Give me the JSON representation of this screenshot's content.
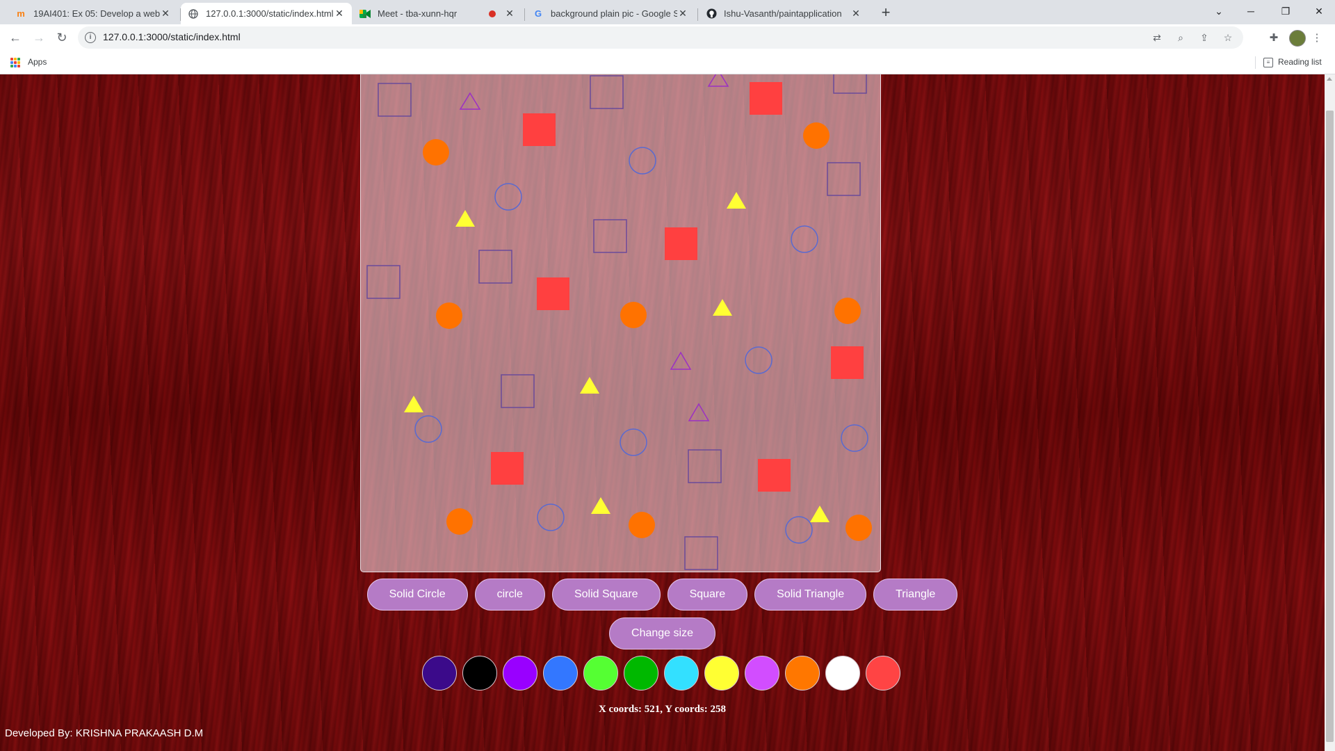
{
  "browser": {
    "tabs": [
      {
        "title": "19AI401: Ex 05: Develop a webpa",
        "icon": "moodle-icon",
        "active": false
      },
      {
        "title": "127.0.0.1:3000/static/index.html",
        "icon": "globe-icon",
        "active": true
      },
      {
        "title": "Meet - tba-xunn-hqr",
        "icon": "meet-icon",
        "active": false,
        "recording": true
      },
      {
        "title": "background plain pic - Google Se",
        "icon": "google-icon",
        "active": false
      },
      {
        "title": "Ishu-Vasanth/paintapplication",
        "icon": "github-icon",
        "active": false
      }
    ],
    "new_tab": "+",
    "url": "127.0.0.1:3000/static/index.html",
    "bookmarks": {
      "apps_label": "Apps",
      "reading_list_label": "Reading list"
    }
  },
  "page": {
    "buttons": {
      "solid_circle": "Solid Circle",
      "circle": "circle",
      "solid_square": "Solid Square",
      "square": "Square",
      "solid_triangle": "Solid Triangle",
      "triangle": "Triangle",
      "change_size": "Change size"
    },
    "palette": [
      "#3b0a8a",
      "#000000",
      "#9900ff",
      "#3377ff",
      "#55ff33",
      "#00b800",
      "#33e0ff",
      "#ffff33",
      "#d24dff",
      "#ff7700",
      "#ffffff",
      "#ff4444"
    ],
    "coords_text": "X coords: 521, Y coords: 258",
    "credit": "Developed By: KRISHNA PRAKAASH D.M",
    "colors": {
      "square_outline": "#6a4a9a",
      "solid_square": "#ff4040",
      "circle_outline": "#5a6ad0",
      "solid_circle": "#ff7200",
      "triangle_outline": "#9b30c4",
      "solid_triangle": "#ffff33",
      "button_bg": "#b57bc6"
    }
  }
}
